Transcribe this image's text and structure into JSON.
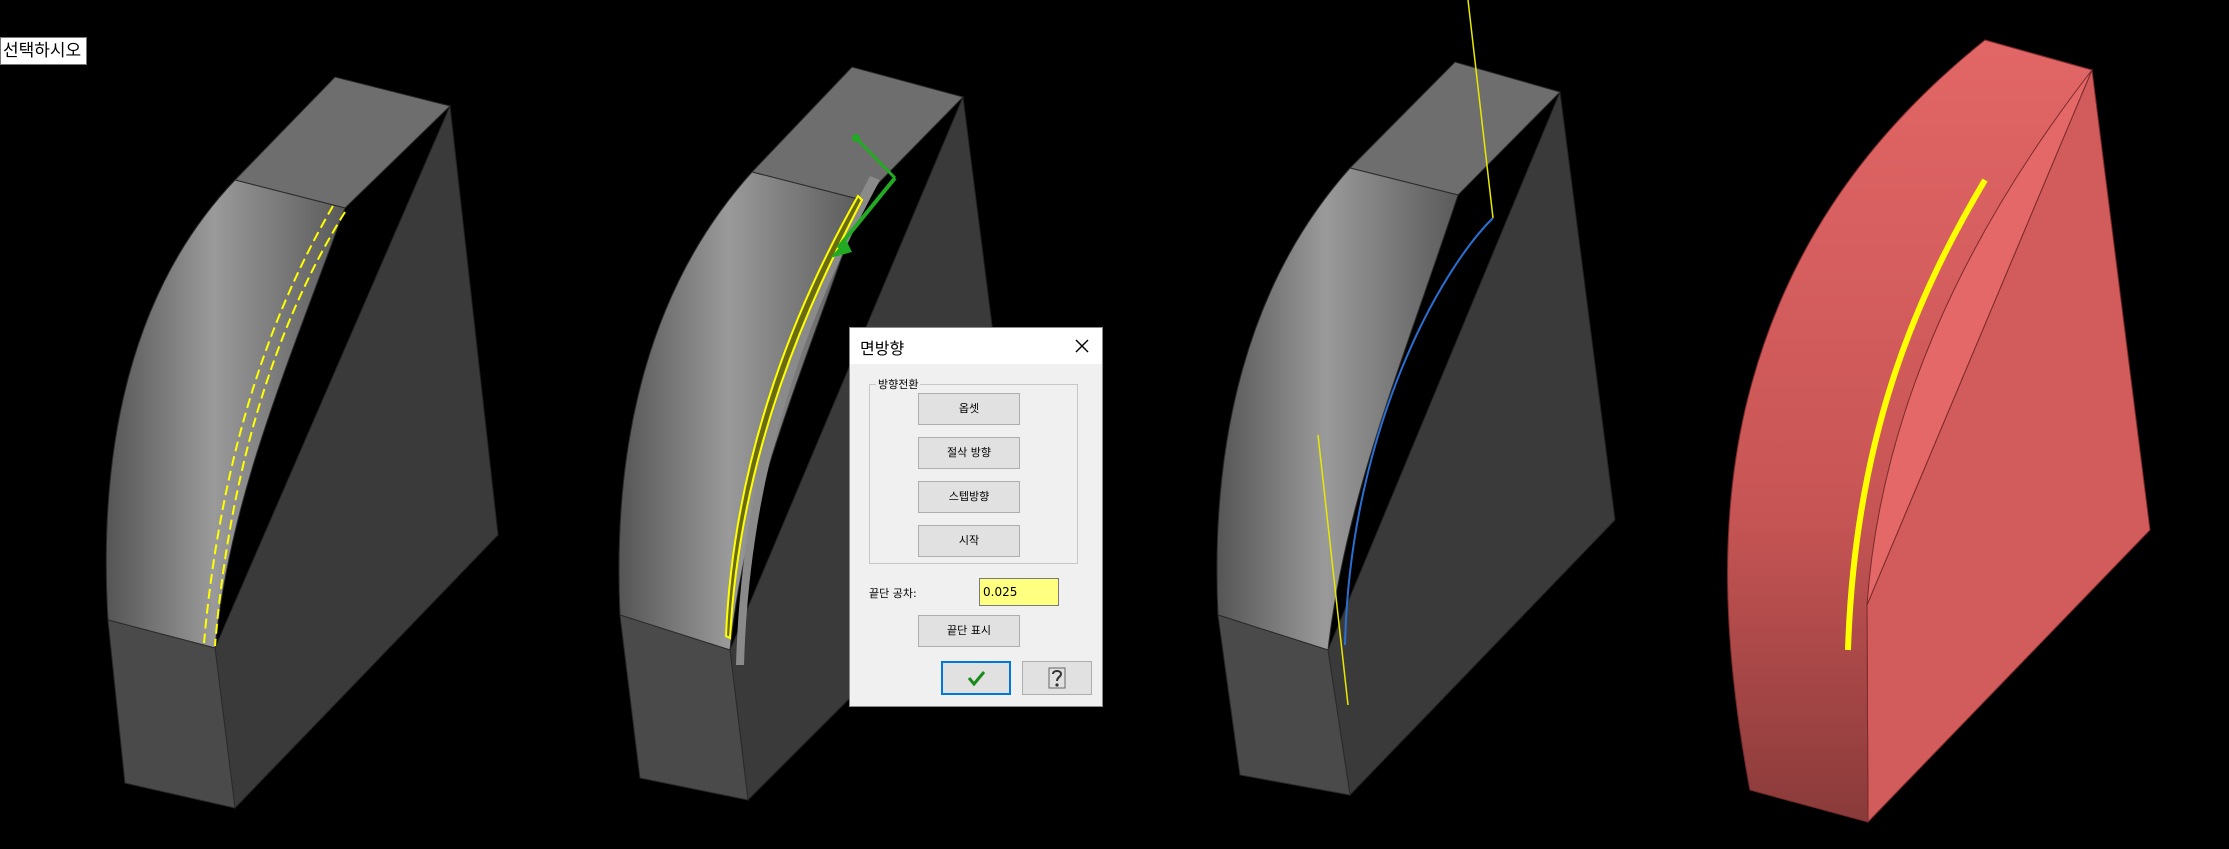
{
  "prompt": {
    "text": "선택하시오"
  },
  "dialog": {
    "title": "면방향",
    "group_label": "방향전환",
    "buttons": [
      {
        "label": "옵셋"
      },
      {
        "label": "절삭 방향"
      },
      {
        "label": "스텝방향"
      },
      {
        "label": "시작"
      }
    ],
    "tolerance_label": "끝단 공차:",
    "tolerance_value": "0.025",
    "show_end_label": "끝단 표시",
    "ok_icon": "checkmark-icon",
    "help_icon": "question-mark-icon",
    "close_icon": "close-icon"
  },
  "colors": {
    "background": "#000000",
    "part_gray": "#5a5a5a",
    "highlight_yellow": "#ffff00",
    "selected_red": "#e06060",
    "arrow_green": "#22aa22",
    "path_blue": "#2a6fd0",
    "tolerance_bg": "#ffff80"
  }
}
